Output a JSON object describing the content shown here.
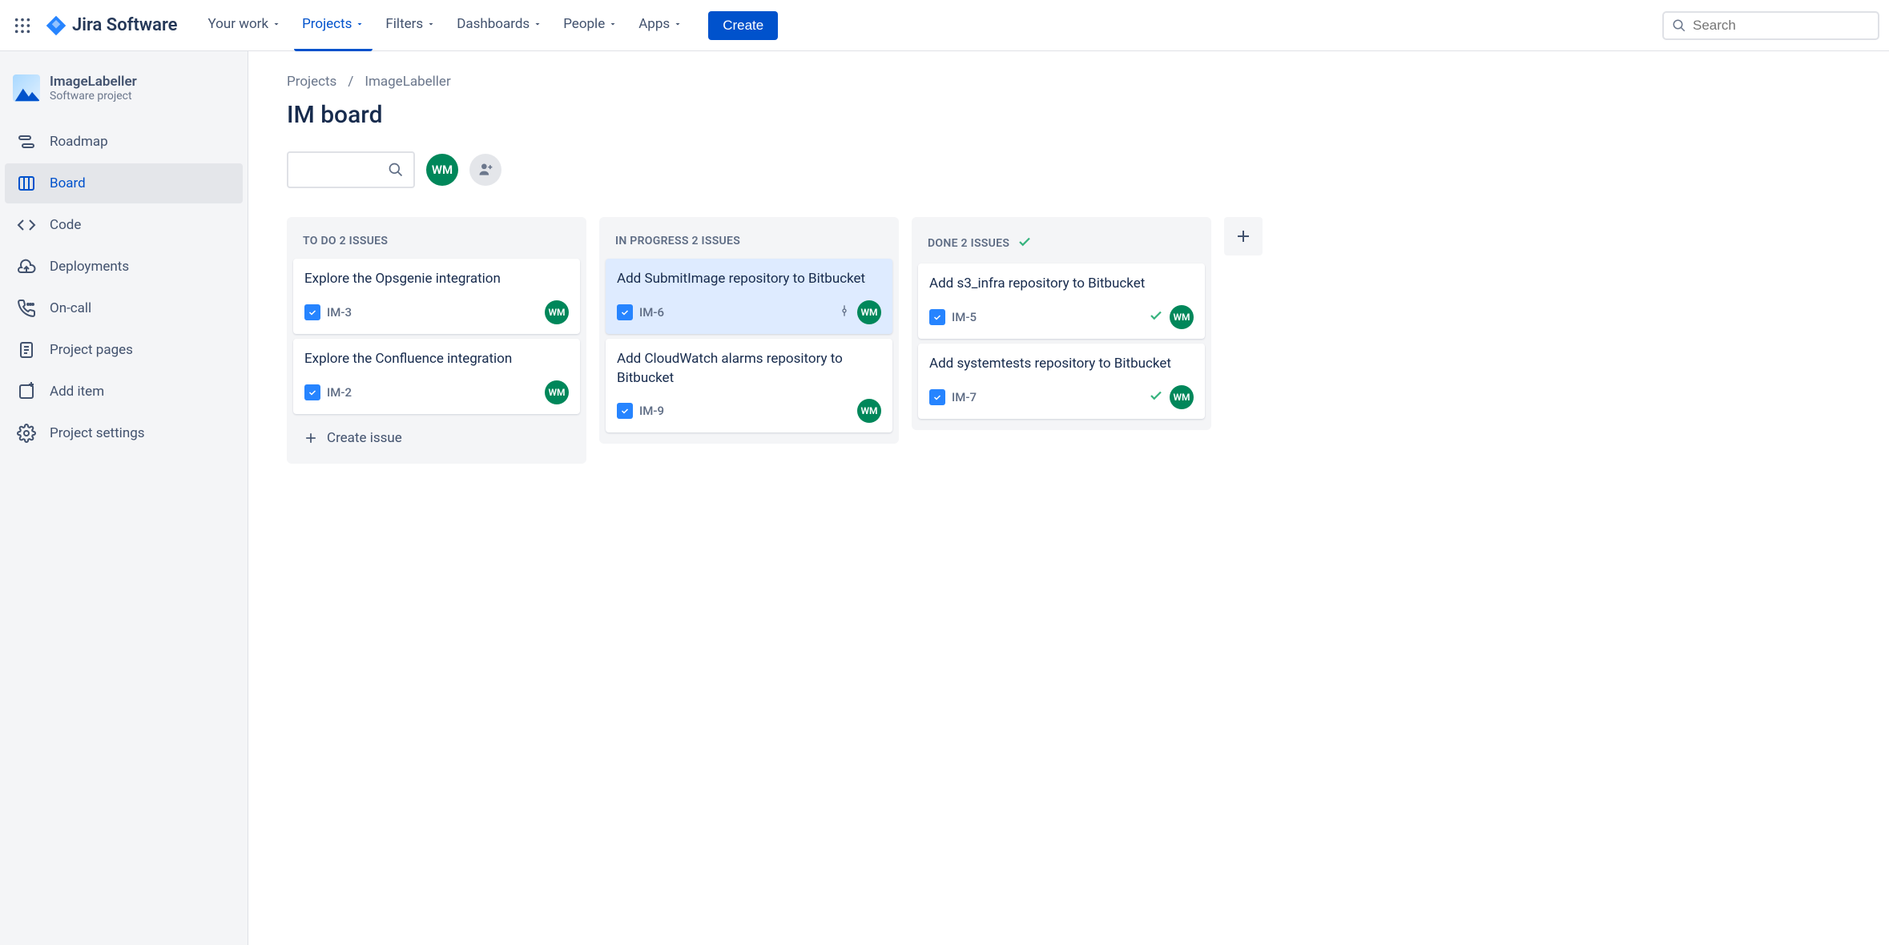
{
  "topnav": {
    "logo_text": "Jira Software",
    "items": [
      "Your work",
      "Projects",
      "Filters",
      "Dashboards",
      "People",
      "Apps"
    ],
    "active_index": 1,
    "create_label": "Create",
    "search_placeholder": "Search"
  },
  "sidebar": {
    "project_name": "ImageLabeller",
    "project_type": "Software project",
    "items": [
      {
        "label": "Roadmap",
        "icon": "roadmap"
      },
      {
        "label": "Board",
        "icon": "board"
      },
      {
        "label": "Code",
        "icon": "code"
      },
      {
        "label": "Deployments",
        "icon": "deployments"
      },
      {
        "label": "On-call",
        "icon": "oncall"
      },
      {
        "label": "Project pages",
        "icon": "pages"
      },
      {
        "label": "Add item",
        "icon": "additem"
      },
      {
        "label": "Project settings",
        "icon": "settings"
      }
    ],
    "active_index": 1
  },
  "breadcrumbs": [
    "Projects",
    "ImageLabeller"
  ],
  "board_title": "IM board",
  "user_initials": "WM",
  "columns": [
    {
      "name": "TO DO",
      "count_label": "2 ISSUES",
      "done": false,
      "cards": [
        {
          "title": "Explore the Opsgenie integration",
          "key": "IM-3",
          "assignee": "WM",
          "highlight": false,
          "done": false,
          "commit": false
        },
        {
          "title": "Explore the Confluence integration",
          "key": "IM-2",
          "assignee": "WM",
          "highlight": false,
          "done": false,
          "commit": false
        }
      ],
      "show_create": true
    },
    {
      "name": "IN PROGRESS",
      "count_label": "2 ISSUES",
      "done": false,
      "cards": [
        {
          "title": "Add SubmitImage repository to Bitbucket",
          "key": "IM-6",
          "assignee": "WM",
          "highlight": true,
          "done": false,
          "commit": true
        },
        {
          "title": "Add CloudWatch alarms repository to Bitbucket",
          "key": "IM-9",
          "assignee": "WM",
          "highlight": false,
          "done": false,
          "commit": false
        }
      ],
      "show_create": false
    },
    {
      "name": "DONE",
      "count_label": "2 ISSUES",
      "done": true,
      "cards": [
        {
          "title": "Add s3_infra repository to Bitbucket",
          "key": "IM-5",
          "assignee": "WM",
          "highlight": false,
          "done": true,
          "commit": false
        },
        {
          "title": "Add systemtests repository to Bitbucket",
          "key": "IM-7",
          "assignee": "WM",
          "highlight": false,
          "done": true,
          "commit": false
        }
      ],
      "show_create": false
    }
  ],
  "create_issue_label": "Create issue"
}
